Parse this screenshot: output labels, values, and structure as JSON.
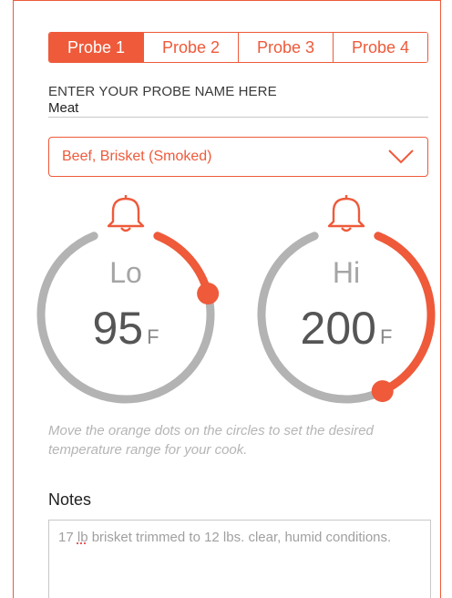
{
  "tabs": [
    {
      "label": "Probe 1",
      "active": true
    },
    {
      "label": "Probe 2",
      "active": false
    },
    {
      "label": "Probe 3",
      "active": false
    },
    {
      "label": "Probe 4",
      "active": false
    }
  ],
  "probe_name": {
    "label": "ENTER YOUR PROBE NAME HERE",
    "value": "Meat"
  },
  "meat_select": {
    "value": "Beef, Brisket (Smoked)"
  },
  "dials": {
    "lo": {
      "label": "Lo",
      "value": "95",
      "unit": "F",
      "level": 0.17
    },
    "hi": {
      "label": "Hi",
      "value": "200",
      "unit": "F",
      "level": 0.42
    }
  },
  "hint": "Move the orange dots on the circles to set the desired temperature range for your cook.",
  "notes": {
    "label": "Notes",
    "text_before": "17 ",
    "spell_word": "lb",
    "text_after": " brisket trimmed to 12 lbs. clear, humid conditions."
  },
  "colors": {
    "accent": "#ee5a3a",
    "track": "#b3b3b3"
  }
}
